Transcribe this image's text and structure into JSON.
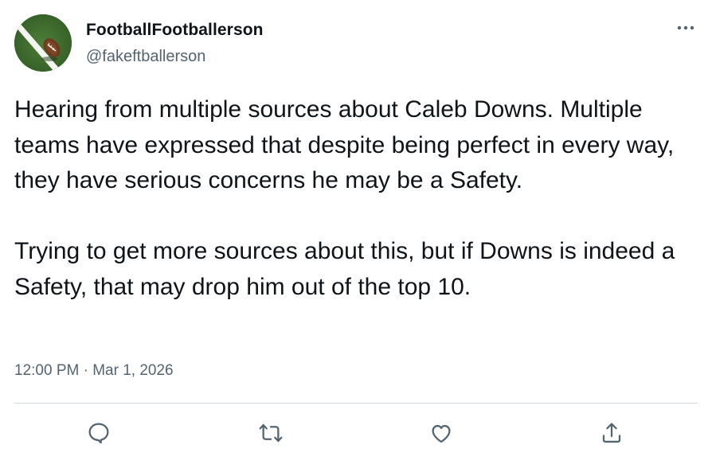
{
  "tweet": {
    "author_name": "FootballFootballerson",
    "author_handle": "@fakeftballerson",
    "paragraphs": [
      "Hearing from multiple sources about Caleb Downs. Multiple teams have expressed that despite being perfect in every way, they have serious concerns he may be a Safety.",
      "Trying to get more sources about this, but if Downs is indeed a Safety, that may drop him out of the top 10."
    ],
    "time": "12:00 PM",
    "separator": "·",
    "date": "Mar 1, 2026"
  },
  "actions": [
    {
      "name": "reply",
      "icon": "reply-icon"
    },
    {
      "name": "retweet",
      "icon": "retweet-icon"
    },
    {
      "name": "like",
      "icon": "heart-icon"
    },
    {
      "name": "share",
      "icon": "share-icon"
    }
  ],
  "colors": {
    "text_primary": "#0f1419",
    "text_secondary": "#536471",
    "divider": "#cfd9de",
    "icon": "#536471"
  }
}
